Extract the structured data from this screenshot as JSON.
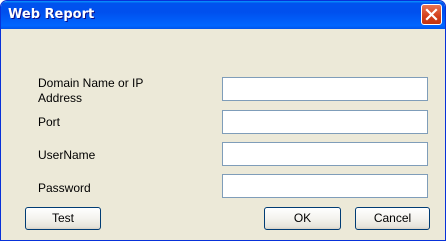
{
  "window": {
    "title": "Web Report",
    "close_icon": "close-icon",
    "colors": {
      "titlebar": "#0054e3",
      "body": "#ece9d8",
      "close_button": "#e0502a",
      "field_border": "#7f9db9"
    }
  },
  "form": {
    "domain_label": "Domain Name or IP Address",
    "domain_value": "",
    "port_label": "Port",
    "port_value": "",
    "username_label": "UserName",
    "username_value": "",
    "password_label": "Password",
    "password_value": ""
  },
  "buttons": {
    "test_label": "Test",
    "ok_label": "OK",
    "cancel_label": "Cancel"
  }
}
